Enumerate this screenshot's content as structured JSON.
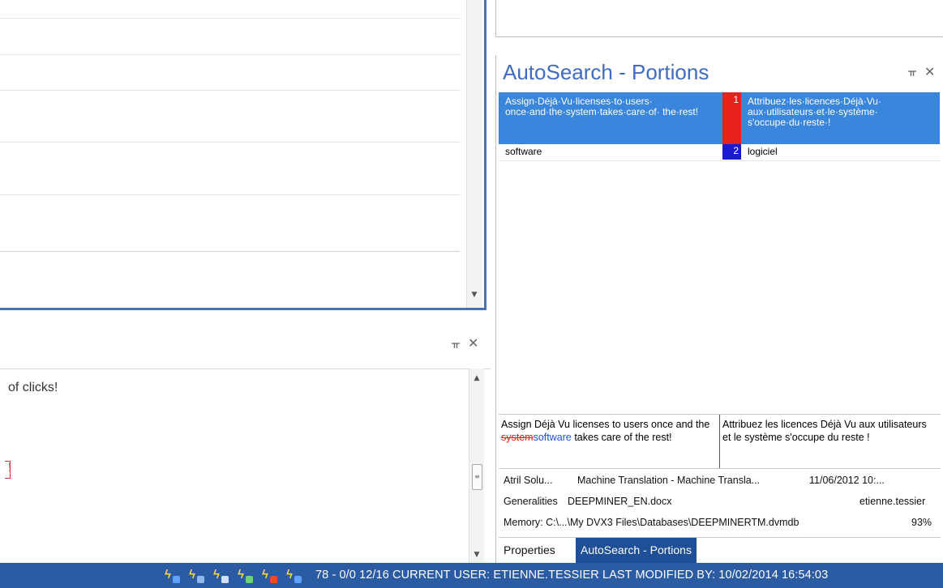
{
  "editor": {
    "preview_text_1": "of clicks!",
    "preview_text_2": "!"
  },
  "autosearch_panel": {
    "title": "AutoSearch - Portions",
    "results": [
      {
        "source": "Assign·Déjà·Vu·licenses·to·users· once·and·the·system·takes·care·of· the·rest!",
        "number": "1",
        "target": "Attribuez·les·licences·Déjà·Vu· aux·utilisateurs·et·le·système· s'occupe·du·reste·!",
        "selected": true,
        "number_color": "#e8201c"
      },
      {
        "source": "software",
        "number": "2",
        "target": "logiciel",
        "selected": false,
        "number_color": "#1a1ad0"
      }
    ],
    "compare": {
      "source_before": "Assign Déjà Vu licenses to users once and the ",
      "source_deleted": "system",
      "source_inserted": "software",
      "source_after": " takes care of the rest!",
      "target": "Attribuez les licences Déjà Vu aux utilisateurs et le système s'occupe du reste !"
    },
    "info": {
      "row1_client": "Atril Solu...",
      "row1_subject": "Machine Translation - Machine Transla...",
      "row1_date": "11/06/2012 10:...",
      "row2_category": "Generalities",
      "row2_file": "DEEPMINER_EN.docx",
      "row2_user": "etienne.tessier",
      "row3_memory": "Memory: C:\\...\\My DVX3 Files\\Databases\\DEEPMINERTM.dvmdb",
      "row3_score": "93%"
    },
    "tabs": [
      "Properties",
      "AutoSearch - Portions"
    ]
  },
  "status_bar": {
    "icons": [
      "lightning-arrow-icon",
      "lightning-a-icon",
      "lightning-aa-icon",
      "lightning-down-icon",
      "lightning-red-icon",
      "lightning-check-icon"
    ],
    "text": "78 - 0/0  12/16  CURRENT USER: ETIENNE.TESSIER  LAST MODIFIED BY:  10/02/2014 16:54:03"
  },
  "colors": {
    "accent": "#3f6cc0",
    "selection": "#3a86dd",
    "status_bar": "#2a5ba3",
    "active_tab": "#1e4f97"
  }
}
